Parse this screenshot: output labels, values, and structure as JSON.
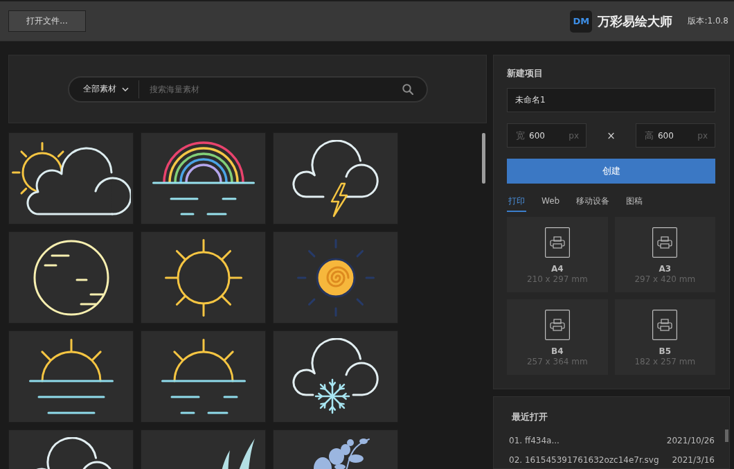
{
  "toolbar": {
    "open_button": "打开文件...",
    "logo_mark": "DM",
    "app_name": "万彩易绘大师",
    "version": "版本:1.0.8"
  },
  "search": {
    "category": "全部素材",
    "placeholder": "搜索海量素材"
  },
  "materials": [
    {
      "kind": "sun-cloud"
    },
    {
      "kind": "rainbow"
    },
    {
      "kind": "storm"
    },
    {
      "kind": "moon"
    },
    {
      "kind": "sun"
    },
    {
      "kind": "spiral-sun"
    },
    {
      "kind": "sunrise"
    },
    {
      "kind": "sunset"
    },
    {
      "kind": "snow"
    },
    {
      "kind": "cloud"
    },
    {
      "kind": "leaves"
    },
    {
      "kind": "branch"
    }
  ],
  "new_project": {
    "title": "新建项目",
    "name": "未命名1",
    "width": {
      "label": "宽",
      "value": "600",
      "unit": "px"
    },
    "separator": "×",
    "height": {
      "label": "高",
      "value": "600",
      "unit": "px"
    },
    "create_button": "创建",
    "tabs": [
      {
        "label": "打印",
        "selected": true
      },
      {
        "label": "Web",
        "selected": false
      },
      {
        "label": "移动设备",
        "selected": false
      },
      {
        "label": "图稿",
        "selected": false
      }
    ],
    "templates": [
      {
        "name": "A4",
        "size": "210 x 297 mm"
      },
      {
        "name": "A3",
        "size": "297 x 420 mm"
      },
      {
        "name": "B4",
        "size": "257 x 364 mm"
      },
      {
        "name": "B5",
        "size": "182 x 257 mm"
      }
    ]
  },
  "recent": {
    "title": "最近打开",
    "files": [
      {
        "name": "01. ff434a...",
        "date": "2021/10/26"
      },
      {
        "name": "02. 161545391761632ozc14e7r.svg",
        "date": "2021/3/16"
      }
    ]
  }
}
